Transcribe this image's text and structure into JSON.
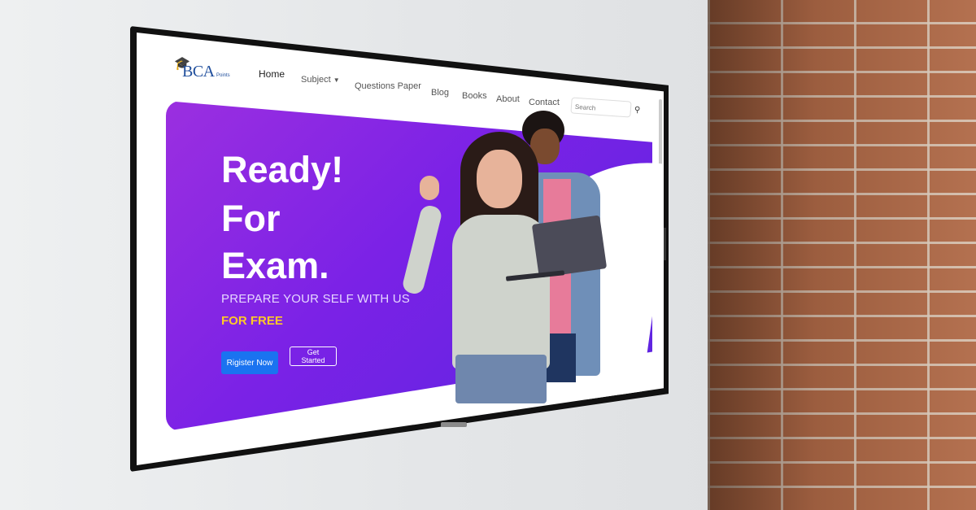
{
  "site": {
    "logo_text": "BCA",
    "logo_sub": "Points"
  },
  "nav": {
    "items": [
      "Home",
      "Subject",
      "Questions Paper",
      "Blog",
      "Books",
      "About",
      "Contact"
    ],
    "active": "Home",
    "search_placeholder": "Search"
  },
  "hero": {
    "line1": "Ready!",
    "line2": "For",
    "line3": "Exam.",
    "subtitle": "PREPARE YOUR SELF WITH US",
    "highlight": "FOR FREE",
    "register_label": "Rigister Now",
    "start_label": "Get Started"
  },
  "colors": {
    "hero_gradient_start": "#9b2fe0",
    "hero_gradient_end": "#5a25e0",
    "highlight": "#ffc928",
    "primary_button": "#1a73f0",
    "logo": "#1f4e9c"
  },
  "icons": {
    "logo": "graduation-cap-icon",
    "subject_dropdown": "caret-down-icon",
    "search": "magnifier-icon"
  }
}
